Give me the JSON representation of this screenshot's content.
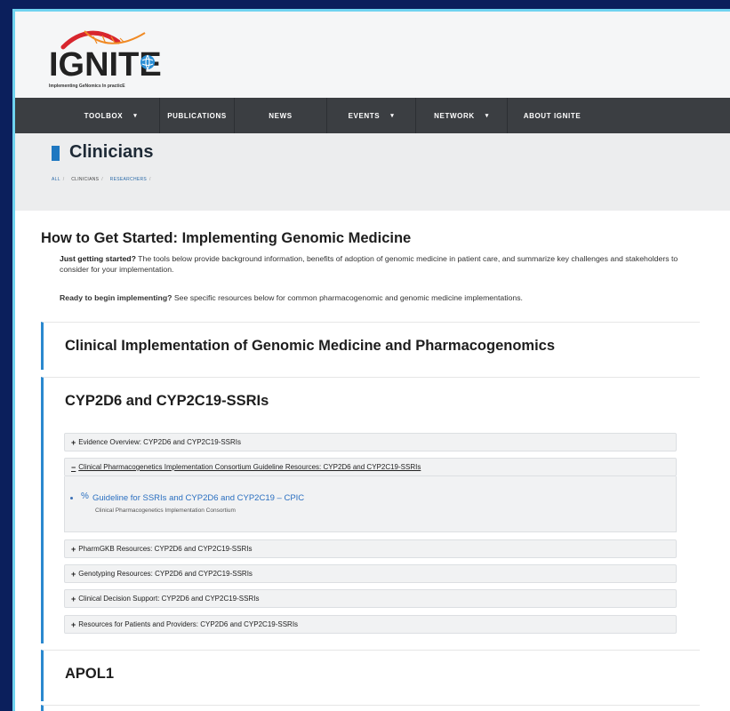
{
  "logo": {
    "word": "IGNITE",
    "tagline": "Implementing GeNomics In practicE"
  },
  "nav": [
    {
      "label": "TOOLBOX",
      "caret": "▾"
    },
    {
      "label": "PUBLICATIONS"
    },
    {
      "label": "NEWS"
    },
    {
      "label": "EVENTS",
      "caret": "▾"
    },
    {
      "label": "NETWORK",
      "caret": "▾"
    },
    {
      "label": "ABOUT IGNITE"
    }
  ],
  "page": {
    "title": "Clinicians",
    "breadcrumb": [
      "ALL",
      "CLINICIANS",
      "RESEARCHERS"
    ]
  },
  "main": {
    "heading": "How to Get Started: Implementing Genomic Medicine",
    "intro_bold": "Just getting started?",
    "intro_text": " The tools below provide background information, benefits of adoption of genomic medicine in patient care, and summarize key challenges and stakeholders to consider for your implementation.",
    "ready_bold": "Ready to begin implementing?",
    "ready_text": " See specific resources below for common pharmacogenomic and genomic medicine implementations."
  },
  "sections": [
    {
      "title": "Clinical Implementation of Genomic Medicine and Pharmacogenomics"
    },
    {
      "title": "CYP2D6 and CYP2C19-SSRIs"
    },
    {
      "title": "APOL1"
    }
  ],
  "accordion": [
    {
      "symbol": "+",
      "label": "Evidence Overview: CYP2D6 and CYP2C19-SSRIs",
      "expanded": false
    },
    {
      "symbol": "−",
      "label": "Clinical Pharmacogenetics Implementation Consortium Guideline Resources: CYP2D6 and CYP2C19-SSRIs",
      "expanded": true
    },
    {
      "symbol": "+",
      "label": "PharmGKB Resources: CYP2D6 and CYP2C19-SSRIs",
      "expanded": false
    },
    {
      "symbol": "+",
      "label": "Genotyping Resources: CYP2D6 and CYP2C19-SSRIs",
      "expanded": false
    },
    {
      "symbol": "+",
      "label": "Clinical Decision Support: CYP2D6 and CYP2C19-SSRIs",
      "expanded": false
    },
    {
      "symbol": "+",
      "label": "Resources for Patients and Providers: CYP2D6 and CYP2C19-SSRIs",
      "expanded": false
    }
  ],
  "cpic_link": {
    "icon": "link-icon",
    "label": "Guideline for SSRIs and CYP2D6 and CYP2C19 – CPIC",
    "source": "Clinical Pharmacogenetics Implementation Consortium"
  },
  "colors": {
    "background": "#0b1f5c",
    "frame_border": "#6fd3f0",
    "nav": "#3b3e42",
    "accent": "#2a88cf",
    "link": "#2a6fc0",
    "logo_red": "#d8262e",
    "logo_orange": "#f08a24",
    "logo_blue": "#2a8fd6"
  }
}
